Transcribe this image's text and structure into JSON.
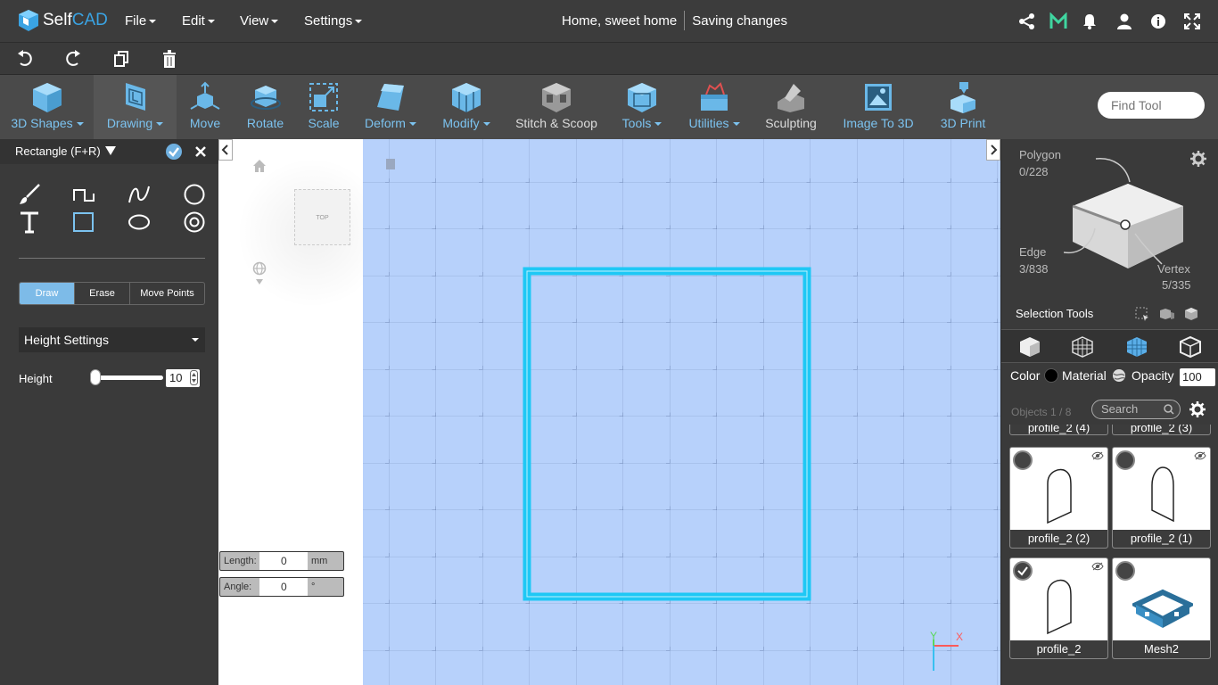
{
  "app": {
    "logo_text_1": "Self",
    "logo_text_2": "CAD"
  },
  "menu": [
    "File",
    "Edit",
    "View",
    "Settings"
  ],
  "project": {
    "title": "Home, sweet home",
    "status": "Saving changes"
  },
  "toolbar": {
    "tools": [
      {
        "label": "3D Shapes",
        "dropdown": true
      },
      {
        "label": "Drawing",
        "dropdown": true
      },
      {
        "label": "Move",
        "dropdown": false
      },
      {
        "label": "Rotate",
        "dropdown": false
      },
      {
        "label": "Scale",
        "dropdown": false
      },
      {
        "label": "Deform",
        "dropdown": true
      },
      {
        "label": "Modify",
        "dropdown": true
      },
      {
        "label": "Stitch & Scoop",
        "dropdown": false
      },
      {
        "label": "Tools",
        "dropdown": true
      },
      {
        "label": "Utilities",
        "dropdown": true
      },
      {
        "label": "Sculpting",
        "dropdown": false
      },
      {
        "label": "Image To 3D",
        "dropdown": false
      },
      {
        "label": "3D Print",
        "dropdown": false
      }
    ],
    "find_placeholder": "Find Tool"
  },
  "left_panel": {
    "title": "Rectangle (F+R)",
    "modes": [
      "Draw",
      "Erase",
      "Move Points"
    ],
    "active_mode": "Draw",
    "height_settings": "Height Settings",
    "height_label": "Height",
    "height_value": "10"
  },
  "viewport": {
    "cube_label": "TOP",
    "length_label": "Length:",
    "length_value": "0",
    "length_unit": "mm",
    "angle_label": "Angle:",
    "angle_value": "0",
    "angle_unit": "°",
    "axis_y": "Y",
    "axis_x": "X"
  },
  "right_panel": {
    "polygon_label": "Polygon",
    "polygon_count": "0/228",
    "edge_label": "Edge",
    "edge_count": "3/838",
    "vertex_label": "Vertex",
    "vertex_count": "5/335",
    "selection_tools": "Selection Tools",
    "color_label": "Color",
    "material_label": "Material",
    "opacity_label": "Opacity",
    "opacity_value": "100",
    "objects_count": "Objects 1 / 8",
    "search_placeholder": "Search",
    "objects": [
      {
        "name": "profile_2 (4)"
      },
      {
        "name": "profile_2 (3)"
      },
      {
        "name": "profile_2 (2)"
      },
      {
        "name": "profile_2 (1)"
      },
      {
        "name": "profile_2",
        "checked": true
      },
      {
        "name": "Mesh2"
      }
    ]
  },
  "colors": {
    "accent": "#7cc3f0",
    "selection": "#1ec8f5",
    "viewport_bg": "#b7d1fb"
  }
}
